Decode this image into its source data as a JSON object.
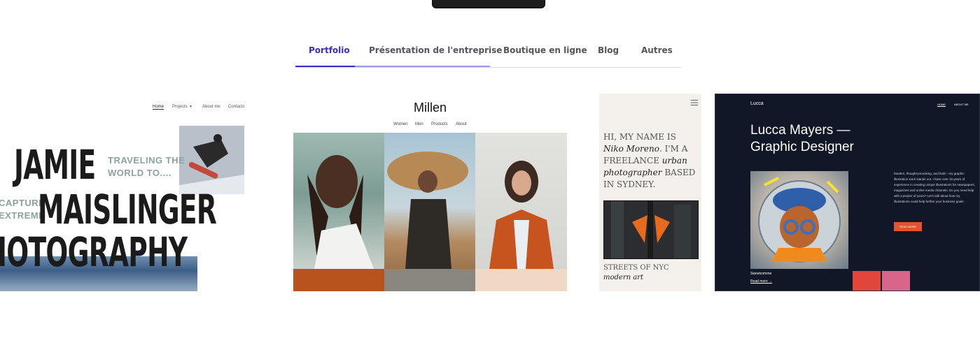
{
  "tabs": [
    "Portfolio",
    "Présentation de l'entreprise",
    "Boutique en ligne",
    "Blog",
    "Autres"
  ],
  "card1": {
    "nav": [
      "Home",
      "Projects",
      "About me",
      "Contacts"
    ],
    "name_line1": "JAMIE",
    "name_line2": "MAISLINGER",
    "name_line3": "IOTOGRAPHY",
    "tagline_line1": "TRAVELING THE",
    "tagline_line2": "WORLD TO....",
    "side_line1": "CAPTURE",
    "side_line2": "EXTREME"
  },
  "card2": {
    "title": "Millen",
    "nav": [
      "Women",
      "Men",
      "Products",
      "About"
    ]
  },
  "card3": {
    "intro_a": "HI, MY NAME IS ",
    "intro_name": "Niko Moreno",
    "intro_b": ". I'M A FREELANCE ",
    "intro_role": "urban photographer",
    "intro_c": " BASED IN SYDNEY.",
    "caption_line1": "STREETS OF NYC",
    "caption_line2": "modern art"
  },
  "card4": {
    "logo": "Lucca",
    "nav": [
      "HOME",
      "ABOUT ME"
    ],
    "title_line1": "Lucca Mayers —",
    "title_line2": "Graphic Designer",
    "body": "Modern, thought-provoking, and bold – my graphic illustration work stands out. I have over 15 years of experience in creating unique illustrations for newspapers, magazines and online media channels. Do you need help with a project of yours? Let's talk about how my illustrations could help further your business goals.",
    "button": "READ MORE",
    "art_title": "Sweetcomme",
    "read_more": "Read more →"
  },
  "colors": {
    "accent": "#3a2ec8",
    "orange": "#e2532f",
    "dark_card": "#111726"
  }
}
